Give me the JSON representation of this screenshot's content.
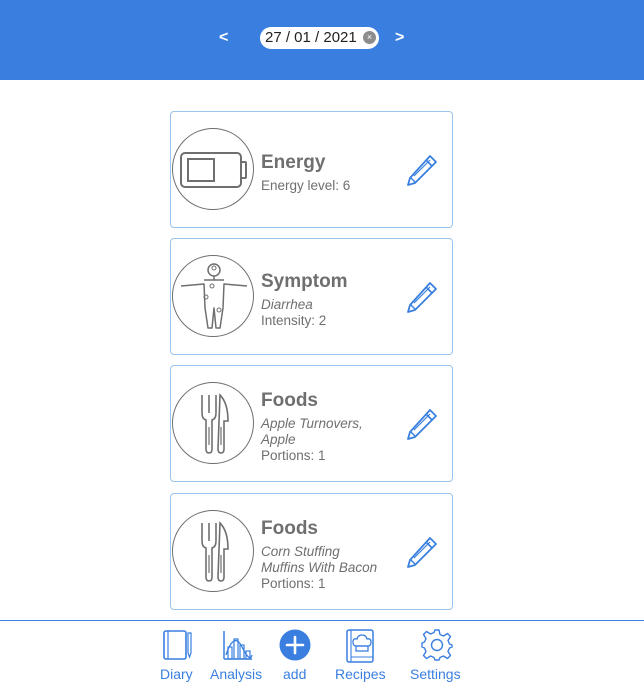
{
  "header": {
    "prev_label": "<",
    "next_label": ">",
    "date_value": "27 / 01 / 2021",
    "clear_glyph": "×"
  },
  "entries": [
    {
      "title": "Energy",
      "detail_italic": "",
      "detail": "Energy level: 6",
      "icon": "battery-icon"
    },
    {
      "title": "Symptom",
      "detail_italic": "Diarrhea",
      "detail": "Intensity: 2",
      "icon": "body-figure-icon"
    },
    {
      "title": "Foods",
      "detail_italic_lines": [
        "Apple Turnovers,",
        "Apple"
      ],
      "detail": "Portions: 1",
      "icon": "cutlery-icon"
    },
    {
      "title": "Foods",
      "detail_italic_lines": [
        "Corn Stuffing",
        "Muffins With Bacon"
      ],
      "detail": "Portions: 1",
      "icon": "cutlery-icon"
    }
  ],
  "tabs": [
    {
      "label": "Diary",
      "icon": "notebook-icon"
    },
    {
      "label": "Analysis",
      "icon": "chart-icon"
    },
    {
      "label": "add",
      "icon": "plus-circle-icon"
    },
    {
      "label": "Recipes",
      "icon": "chef-book-icon"
    },
    {
      "label": "Settings",
      "icon": "gear-icon"
    }
  ],
  "colors": {
    "accent": "#3a7fe0",
    "text": "#6f6f6f",
    "card_border": "#9cc3ea"
  }
}
